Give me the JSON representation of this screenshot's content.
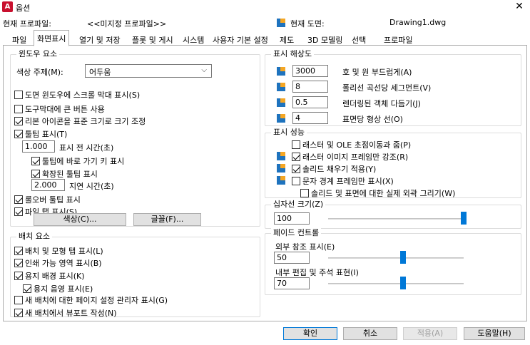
{
  "window": {
    "title": "옵션",
    "app_icon_letter": "A"
  },
  "profile": {
    "current_profile_label": "현재 프로파일:",
    "current_profile_value": "<<미지정 프로파일>>",
    "current_drawing_label": "현재 도면:",
    "current_drawing_value": "Drawing1.dwg"
  },
  "tabs": [
    "파일",
    "화면표시",
    "열기 및 저장",
    "플롯 및 게시",
    "시스템",
    "사용자 기본 설정",
    "제도",
    "3D 모델링",
    "선택",
    "프로파일"
  ],
  "active_tab": "화면표시",
  "window_elements": {
    "title": "윈도우 요소",
    "color_scheme_label": "색상 주제(M):",
    "color_scheme_value": "어두움",
    "scrollbars": "도면 윈도우에 스크롤 막대 표시(S)",
    "large_buttons": "도구막대에 큰 버튼 사용",
    "resize_ribbon_icons": "리본 아이콘을 표준 크기로 크기 조정",
    "tooltips": "툴팁 표시(T)",
    "tooltip_delay_value": "1.000",
    "tooltip_delay_label": "표시 전 시간(초)",
    "shortcut_keys": "툴팁에 바로 가기 키 표시",
    "extended_tooltips": "확장된 툴팁 표시",
    "extended_delay_value": "2.000",
    "extended_delay_label": "지연 시간(초)",
    "rollover_tooltips": "롤오버 툴팁 표시",
    "file_tabs": "파일 탭 표시(S)",
    "colors_button": "색상(C)...",
    "fonts_button": "글꼴(F)..."
  },
  "layout_elements": {
    "title": "배치 요소",
    "layout_model_tabs": "배치 및 모형 탭 표시(L)",
    "printable_area": "인쇄 가능 영역 표시(B)",
    "paper_background": "용지 배경 표시(K)",
    "paper_shadow": "용지 음영 표시(E)",
    "page_setup_manager": "새 배치에 대한 페이지 설정 관리자 표시(G)",
    "create_viewport": "새 배치에서 뷰포트 작성(N)"
  },
  "display_resolution": {
    "title": "표시 해상도",
    "arc_smoothness_value": "3000",
    "arc_smoothness_label": "호 및 원 부드럽게(A)",
    "polyline_segments_value": "8",
    "polyline_segments_label": "폴리선 곡선당 세그먼트(V)",
    "rendered_smoothness_value": "0.5",
    "rendered_smoothness_label": "렌더링된 객체 다듬기(J)",
    "contour_lines_value": "4",
    "contour_lines_label": "표면당 형상 선(O)"
  },
  "display_performance": {
    "title": "표시 성능",
    "raster_ole": "래스터 및 OLE 초점이동과 줌(P)",
    "raster_frame": "래스터 이미지 프레임만 강조(R)",
    "solid_fill": "솔리드 채우기 적용(Y)",
    "text_boundary": "문자 경계 프레임만 표시(X)",
    "true_silhouettes": "솔리드 및 표면에 대한 실제 외곽 그리기(W)"
  },
  "crosshair": {
    "title": "십자선 크기(Z)",
    "value": "100",
    "fraction": 1.0
  },
  "fade_control": {
    "title": "페이드 컨트롤",
    "xref_label": "외부 참조 표시(E)",
    "xref_value": "50",
    "xref_fraction": 0.55,
    "inplace_label": "내부 편집 및 주석 표현(I)",
    "inplace_value": "70",
    "inplace_fraction": 0.55
  },
  "footer": {
    "ok": "확인",
    "cancel": "취소",
    "apply": "적용(A)",
    "help": "도움말(H)"
  },
  "colors": {
    "accent": "#0078d7",
    "brand": "#c8102e"
  }
}
